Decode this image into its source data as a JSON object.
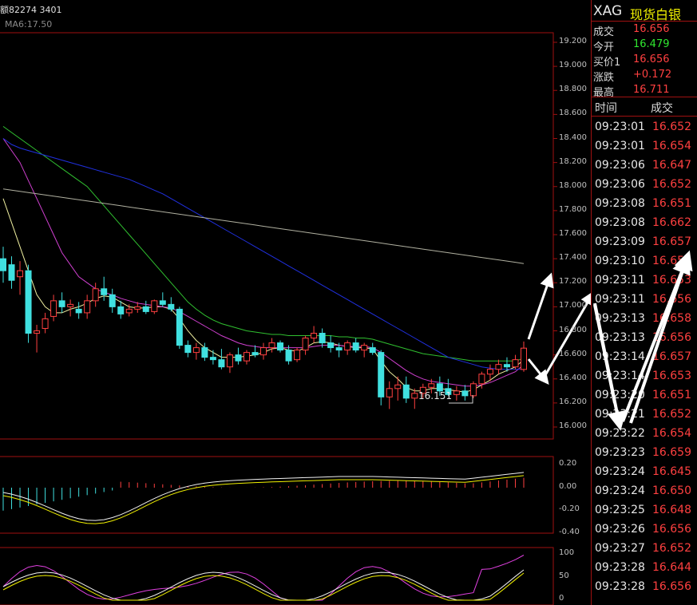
{
  "header": {
    "volume_text": "额82274 3401",
    "ma_text": "MA6:17.50"
  },
  "quote": {
    "symbol": "XAG",
    "name": "现货白银",
    "rows": [
      {
        "label": "成交",
        "value": "16.656",
        "color": "#ff4040"
      },
      {
        "label": "今开",
        "value": "16.479",
        "color": "#30e830"
      },
      {
        "label": "买价1",
        "value": "16.656",
        "color": "#ff4040"
      },
      {
        "label": "涨跌",
        "value": "+0.172",
        "color": "#ff4040"
      },
      {
        "label": "最高",
        "value": "16.711",
        "color": "#ff4040"
      }
    ]
  },
  "ticks_header": {
    "time": "时间",
    "price": "成交"
  },
  "ticks": [
    {
      "time": "09:23:01",
      "price": "16.652"
    },
    {
      "time": "09:23:01",
      "price": "16.654"
    },
    {
      "time": "09:23:06",
      "price": "16.647"
    },
    {
      "time": "09:23:06",
      "price": "16.652"
    },
    {
      "time": "09:23:08",
      "price": "16.651"
    },
    {
      "time": "09:23:08",
      "price": "16.662"
    },
    {
      "time": "09:23:09",
      "price": "16.657"
    },
    {
      "time": "09:23:10",
      "price": "16.650"
    },
    {
      "time": "09:23:11",
      "price": "16.653"
    },
    {
      "time": "09:23:11",
      "price": "16.656"
    },
    {
      "time": "09:23:13",
      "price": "16.658"
    },
    {
      "time": "09:23:13",
      "price": "16.656"
    },
    {
      "time": "09:23:14",
      "price": "16.657"
    },
    {
      "time": "09:23:14",
      "price": "16.653"
    },
    {
      "time": "09:23:20",
      "price": "16.651"
    },
    {
      "time": "09:23:21",
      "price": "16.652"
    },
    {
      "time": "09:23:22",
      "price": "16.654"
    },
    {
      "time": "09:23:23",
      "price": "16.659"
    },
    {
      "time": "09:23:24",
      "price": "16.645"
    },
    {
      "time": "09:23:24",
      "price": "16.650"
    },
    {
      "time": "09:23:25",
      "price": "16.648"
    },
    {
      "time": "09:23:26",
      "price": "16.656"
    },
    {
      "time": "09:23:27",
      "price": "16.652"
    },
    {
      "time": "09:23:28",
      "price": "16.644"
    },
    {
      "time": "09:23:28",
      "price": "16.656"
    }
  ],
  "chart_data": {
    "type": "candlestick",
    "price_axis": [
      "19.200",
      "19.000",
      "18.800",
      "18.600",
      "18.400",
      "18.200",
      "18.000",
      "17.800",
      "17.600",
      "17.400",
      "17.200",
      "17.000",
      "16.800",
      "16.600",
      "16.400",
      "16.200",
      "16.000"
    ],
    "ylim": [
      16.0,
      19.2
    ],
    "low_annotation": "16.151",
    "macd_axis": [
      "0.20",
      "0.00",
      "-0.20",
      "-0.40"
    ],
    "kdj_axis": [
      "100",
      "50",
      "0"
    ],
    "candles": [
      {
        "o": 17.4,
        "h": 17.5,
        "l": 17.2,
        "c": 17.3
      },
      {
        "o": 17.35,
        "h": 17.42,
        "l": 17.15,
        "c": 17.22
      },
      {
        "o": 17.25,
        "h": 17.38,
        "l": 17.1,
        "c": 17.3
      },
      {
        "o": 17.3,
        "h": 17.35,
        "l": 16.7,
        "c": 16.78
      },
      {
        "o": 16.78,
        "h": 16.85,
        "l": 16.62,
        "c": 16.8
      },
      {
        "o": 16.82,
        "h": 16.95,
        "l": 16.78,
        "c": 16.9
      },
      {
        "o": 16.92,
        "h": 17.1,
        "l": 16.88,
        "c": 17.05
      },
      {
        "o": 17.05,
        "h": 17.12,
        "l": 16.95,
        "c": 17.0
      },
      {
        "o": 17.0,
        "h": 17.06,
        "l": 16.92,
        "c": 17.02
      },
      {
        "o": 16.98,
        "h": 17.04,
        "l": 16.9,
        "c": 16.95
      },
      {
        "o": 16.95,
        "h": 17.1,
        "l": 16.9,
        "c": 17.05
      },
      {
        "o": 17.05,
        "h": 17.2,
        "l": 17.0,
        "c": 17.15
      },
      {
        "o": 17.15,
        "h": 17.25,
        "l": 17.05,
        "c": 17.1
      },
      {
        "o": 17.1,
        "h": 17.15,
        "l": 16.95,
        "c": 17.0
      },
      {
        "o": 17.0,
        "h": 17.05,
        "l": 16.9,
        "c": 16.94
      },
      {
        "o": 16.95,
        "h": 17.02,
        "l": 16.92,
        "c": 16.98
      },
      {
        "o": 16.98,
        "h": 17.04,
        "l": 16.95,
        "c": 17.0
      },
      {
        "o": 17.0,
        "h": 17.05,
        "l": 16.94,
        "c": 16.96
      },
      {
        "o": 16.96,
        "h": 17.06,
        "l": 16.94,
        "c": 17.05
      },
      {
        "o": 17.05,
        "h": 17.12,
        "l": 17.0,
        "c": 17.02
      },
      {
        "o": 17.02,
        "h": 17.08,
        "l": 16.96,
        "c": 16.98
      },
      {
        "o": 16.98,
        "h": 17.0,
        "l": 16.65,
        "c": 16.68
      },
      {
        "o": 16.68,
        "h": 16.72,
        "l": 16.58,
        "c": 16.62
      },
      {
        "o": 16.62,
        "h": 16.7,
        "l": 16.56,
        "c": 16.66
      },
      {
        "o": 16.66,
        "h": 16.7,
        "l": 16.55,
        "c": 16.58
      },
      {
        "o": 16.58,
        "h": 16.64,
        "l": 16.52,
        "c": 16.56
      },
      {
        "o": 16.56,
        "h": 16.65,
        "l": 16.48,
        "c": 16.5
      },
      {
        "o": 16.5,
        "h": 16.62,
        "l": 16.45,
        "c": 16.6
      },
      {
        "o": 16.6,
        "h": 16.66,
        "l": 16.52,
        "c": 16.55
      },
      {
        "o": 16.55,
        "h": 16.64,
        "l": 16.52,
        "c": 16.62
      },
      {
        "o": 16.62,
        "h": 16.68,
        "l": 16.58,
        "c": 16.6
      },
      {
        "o": 16.6,
        "h": 16.7,
        "l": 16.56,
        "c": 16.66
      },
      {
        "o": 16.66,
        "h": 16.74,
        "l": 16.62,
        "c": 16.7
      },
      {
        "o": 16.7,
        "h": 16.72,
        "l": 16.62,
        "c": 16.64
      },
      {
        "o": 16.64,
        "h": 16.68,
        "l": 16.52,
        "c": 16.55
      },
      {
        "o": 16.56,
        "h": 16.66,
        "l": 16.54,
        "c": 16.64
      },
      {
        "o": 16.64,
        "h": 16.76,
        "l": 16.6,
        "c": 16.74
      },
      {
        "o": 16.74,
        "h": 16.84,
        "l": 16.7,
        "c": 16.78
      },
      {
        "o": 16.78,
        "h": 16.82,
        "l": 16.66,
        "c": 16.7
      },
      {
        "o": 16.7,
        "h": 16.76,
        "l": 16.62,
        "c": 16.66
      },
      {
        "o": 16.66,
        "h": 16.7,
        "l": 16.58,
        "c": 16.64
      },
      {
        "o": 16.64,
        "h": 16.72,
        "l": 16.6,
        "c": 16.7
      },
      {
        "o": 16.7,
        "h": 16.74,
        "l": 16.62,
        "c": 16.64
      },
      {
        "o": 16.64,
        "h": 16.7,
        "l": 16.58,
        "c": 16.68
      },
      {
        "o": 16.66,
        "h": 16.7,
        "l": 16.6,
        "c": 16.62
      },
      {
        "o": 16.62,
        "h": 16.64,
        "l": 16.18,
        "c": 16.25
      },
      {
        "o": 16.25,
        "h": 16.38,
        "l": 16.15,
        "c": 16.32
      },
      {
        "o": 16.32,
        "h": 16.42,
        "l": 16.22,
        "c": 16.35
      },
      {
        "o": 16.35,
        "h": 16.42,
        "l": 16.2,
        "c": 16.24
      },
      {
        "o": 16.24,
        "h": 16.32,
        "l": 16.151,
        "c": 16.28
      },
      {
        "o": 16.28,
        "h": 16.36,
        "l": 16.24,
        "c": 16.33
      },
      {
        "o": 16.33,
        "h": 16.4,
        "l": 16.28,
        "c": 16.36
      },
      {
        "o": 16.36,
        "h": 16.42,
        "l": 16.26,
        "c": 16.3
      },
      {
        "o": 16.32,
        "h": 16.4,
        "l": 16.26,
        "c": 16.27
      },
      {
        "o": 16.27,
        "h": 16.34,
        "l": 16.22,
        "c": 16.3
      },
      {
        "o": 16.3,
        "h": 16.35,
        "l": 16.22,
        "c": 16.26
      },
      {
        "o": 16.26,
        "h": 16.38,
        "l": 16.24,
        "c": 16.36
      },
      {
        "o": 16.36,
        "h": 16.46,
        "l": 16.32,
        "c": 16.44
      },
      {
        "o": 16.44,
        "h": 16.52,
        "l": 16.38,
        "c": 16.48
      },
      {
        "o": 16.48,
        "h": 16.56,
        "l": 16.44,
        "c": 16.52
      },
      {
        "o": 16.52,
        "h": 16.58,
        "l": 16.46,
        "c": 16.5
      },
      {
        "o": 16.5,
        "h": 16.6,
        "l": 16.48,
        "c": 16.56
      },
      {
        "o": 16.479,
        "h": 16.711,
        "l": 16.46,
        "c": 16.656
      }
    ],
    "ma_lines": [
      {
        "color": "#f0f0a0",
        "values": [
          17.9,
          17.7,
          17.5,
          17.3,
          17.1,
          17.0,
          16.95,
          16.95,
          16.98,
          17.0,
          17.03,
          17.07,
          17.09,
          17.08,
          17.04,
          17.0,
          16.99,
          16.99,
          17.0,
          17.0,
          16.98,
          16.9,
          16.8,
          16.72,
          16.66,
          16.62,
          16.58,
          16.58,
          16.58,
          16.59,
          16.6,
          16.62,
          16.65,
          16.66,
          16.64,
          16.63,
          16.66,
          16.7,
          16.71,
          16.7,
          16.68,
          16.67,
          16.66,
          16.66,
          16.65,
          16.55,
          16.46,
          16.4,
          16.33,
          16.3,
          16.3,
          16.32,
          16.32,
          16.31,
          16.3,
          16.29,
          16.31,
          16.35,
          16.39,
          16.44,
          16.47,
          16.5,
          16.56
        ]
      },
      {
        "color": "#d040d0",
        "values": [
          18.4,
          18.3,
          18.2,
          18.05,
          17.9,
          17.75,
          17.6,
          17.45,
          17.35,
          17.25,
          17.2,
          17.15,
          17.12,
          17.1,
          17.07,
          17.05,
          17.03,
          17.02,
          17.01,
          17.0,
          16.99,
          16.96,
          16.92,
          16.88,
          16.84,
          16.8,
          16.76,
          16.73,
          16.7,
          16.68,
          16.67,
          16.66,
          16.66,
          16.66,
          16.66,
          16.66,
          16.66,
          16.67,
          16.68,
          16.68,
          16.68,
          16.67,
          16.67,
          16.67,
          16.66,
          16.62,
          16.57,
          16.52,
          16.47,
          16.43,
          16.4,
          16.38,
          16.37,
          16.36,
          16.35,
          16.34,
          16.34,
          16.35,
          16.37,
          16.4,
          16.43,
          16.46,
          16.52
        ]
      },
      {
        "color": "#30c030",
        "values": [
          18.5,
          18.45,
          18.4,
          18.35,
          18.3,
          18.25,
          18.2,
          18.15,
          18.1,
          18.05,
          18.0,
          17.92,
          17.84,
          17.76,
          17.68,
          17.6,
          17.52,
          17.44,
          17.36,
          17.28,
          17.2,
          17.12,
          17.04,
          16.98,
          16.93,
          16.89,
          16.86,
          16.84,
          16.82,
          16.8,
          16.79,
          16.78,
          16.77,
          16.77,
          16.76,
          16.76,
          16.76,
          16.76,
          16.76,
          16.76,
          16.75,
          16.75,
          16.74,
          16.74,
          16.73,
          16.71,
          16.69,
          16.67,
          16.65,
          16.63,
          16.61,
          16.6,
          16.59,
          16.58,
          16.57,
          16.56,
          16.55,
          16.55,
          16.55,
          16.55,
          16.55,
          16.55,
          16.57
        ]
      },
      {
        "color": "#2030e0",
        "values": [
          18.4,
          18.35,
          18.32,
          18.3,
          18.28,
          18.26,
          18.24,
          18.22,
          18.2,
          18.18,
          18.16,
          18.14,
          18.12,
          18.1,
          18.08,
          18.06,
          18.03,
          18.0,
          17.97,
          17.94,
          17.9,
          17.86,
          17.82,
          17.78,
          17.74,
          17.7,
          17.66,
          17.62,
          17.58,
          17.54,
          17.5,
          17.46,
          17.42,
          17.38,
          17.34,
          17.3,
          17.26,
          17.22,
          17.18,
          17.14,
          17.1,
          17.06,
          17.02,
          16.98,
          16.94,
          16.9,
          16.86,
          16.82,
          16.78,
          16.74,
          16.7,
          16.66,
          16.62,
          16.58,
          16.56,
          16.54,
          16.52,
          16.5,
          16.49,
          16.48,
          16.48,
          16.48,
          16.48
        ]
      },
      {
        "color": "#b0b0a0",
        "values": [
          17.98,
          17.97,
          17.96,
          17.95,
          17.94,
          17.93,
          17.92,
          17.91,
          17.9,
          17.89,
          17.88,
          17.87,
          17.86,
          17.85,
          17.84,
          17.83,
          17.82,
          17.81,
          17.8,
          17.79,
          17.78,
          17.77,
          17.76,
          17.75,
          17.74,
          17.73,
          17.72,
          17.71,
          17.7,
          17.69,
          17.68,
          17.67,
          17.66,
          17.65,
          17.64,
          17.63,
          17.62,
          17.61,
          17.6,
          17.59,
          17.58,
          17.57,
          17.56,
          17.55,
          17.54,
          17.53,
          17.52,
          17.51,
          17.5,
          17.49,
          17.48,
          17.47,
          17.46,
          17.45,
          17.44,
          17.43,
          17.42,
          17.41,
          17.4,
          17.39,
          17.38,
          17.37,
          17.36
        ]
      }
    ]
  }
}
